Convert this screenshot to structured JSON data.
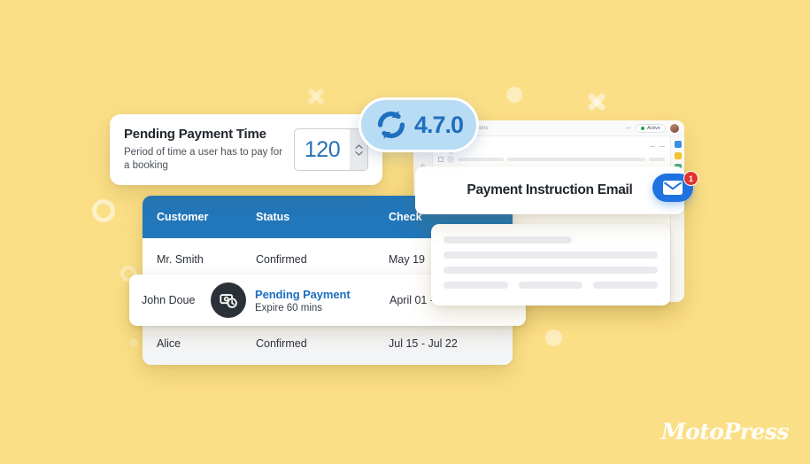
{
  "theme": {
    "background": "#fbdf87",
    "accent_blue": "#2277ba",
    "link_blue": "#1c6fc0",
    "badge_blue": "#b9dcf5",
    "notification_red": "#e0332b",
    "dark": "#2b3138"
  },
  "version_badge": {
    "icon": "sync-icon",
    "label": "4.7.0"
  },
  "settings_card": {
    "title": "Pending Payment Time",
    "description": "Period of time a user has to pay for a booking",
    "input_value": "120",
    "stepper_up_icon": "chevron-up-icon",
    "stepper_down_icon": "chevron-down-icon"
  },
  "bookings_table": {
    "columns": [
      "Customer",
      "Status",
      "Check"
    ],
    "rows": [
      {
        "customer": "Mr. Smith",
        "status": "Confirmed",
        "dates": "May 19"
      },
      {
        "customer": "",
        "status": "",
        "dates": ""
      },
      {
        "customer": "Alice",
        "status": "Confirmed",
        "dates": "Jul 15 - Jul 22"
      }
    ]
  },
  "pending_row": {
    "customer": "John Doue",
    "icon": "payment-clock-icon",
    "status_label": "Pending Payment",
    "expire_text": "Expire 60 mins",
    "dates": "April 01 -"
  },
  "inbox_window": {
    "search_placeholder": "Search all conversations",
    "status_pill": "Active",
    "avatar": "user-avatar"
  },
  "email_panel": {
    "title": "Payment Instruction Email",
    "notification_count": "1",
    "notification_icon": "envelope-icon"
  },
  "branding": {
    "logo_text": "MotoPress"
  }
}
